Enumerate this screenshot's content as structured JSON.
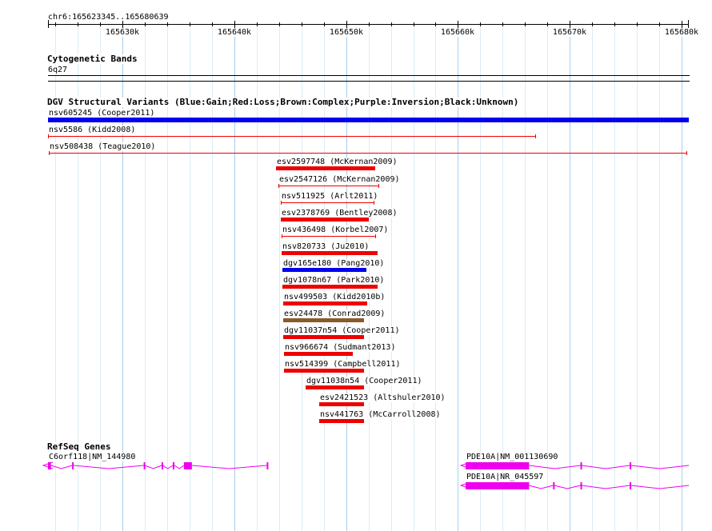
{
  "ruler": {
    "range_label": "chr6:165623345..165680639",
    "start": 165623345,
    "end": 165680639,
    "ticks": [
      {
        "pos": 165630000,
        "label": "165630k"
      },
      {
        "pos": 165640000,
        "label": "165640k"
      },
      {
        "pos": 165650000,
        "label": "165650k"
      },
      {
        "pos": 165660000,
        "label": "165660k"
      },
      {
        "pos": 165670000,
        "label": "165670k"
      },
      {
        "pos": 165680000,
        "label": "165680k"
      }
    ]
  },
  "cyto": {
    "title": "Cytogenetic Bands",
    "band": "6q27"
  },
  "dgv": {
    "title": "DGV Structural Variants (Blue:Gain;Red:Loss;Brown:Complex;Purple:Inversion;Black:Unknown)",
    "colors": {
      "gain": "#0000ee",
      "loss": "#ee0000",
      "complex": "#8b5a2b"
    },
    "variants": [
      {
        "label": "nsv605245 (Cooper2011)",
        "type": "gain",
        "style": "bar",
        "start": 165623345,
        "end": 165680639
      },
      {
        "label": "nsv5586 (Kidd2008)",
        "type": "loss",
        "style": "line",
        "start": 165623345,
        "end": 165667000
      },
      {
        "label": "nsv508438 (Teague2010)",
        "type": "loss",
        "style": "line",
        "start": 165623400,
        "end": 165680500
      },
      {
        "label": "esv2597748 (McKernan2009)",
        "type": "loss",
        "style": "bar",
        "start": 165643700,
        "end": 165652600
      },
      {
        "label": "esv2547126 (McKernan2009)",
        "type": "loss",
        "style": "line",
        "start": 165643950,
        "end": 165652950
      },
      {
        "label": "nsv511925 (Arlt2011)",
        "type": "loss",
        "style": "line",
        "start": 165644150,
        "end": 165652550
      },
      {
        "label": "esv2378769 (Bentley2008)",
        "type": "loss",
        "style": "bar",
        "start": 165644150,
        "end": 165652050
      },
      {
        "label": "nsv436498 (Korbel2007)",
        "type": "loss",
        "style": "line",
        "start": 165644250,
        "end": 165652650
      },
      {
        "label": "nsv820733 (Ju2010)",
        "type": "loss",
        "style": "bar",
        "start": 165644250,
        "end": 165652800
      },
      {
        "label": "dgv165e180 (Pang2010)",
        "type": "gain",
        "style": "bar",
        "start": 165644320,
        "end": 165651800
      },
      {
        "label": "dgv1078n67 (Park2010)",
        "type": "loss",
        "style": "bar",
        "start": 165644320,
        "end": 165652800
      },
      {
        "label": "nsv499503 (Kidd2010b)",
        "type": "loss",
        "style": "bar",
        "start": 165644400,
        "end": 165651900
      },
      {
        "label": "esv24478 (Conrad2009)",
        "type": "complex",
        "style": "bar",
        "start": 165644400,
        "end": 165651600
      },
      {
        "label": "dgv11037n54 (Cooper2011)",
        "type": "loss",
        "style": "bar",
        "start": 165644400,
        "end": 165651600
      },
      {
        "label": "nsv966674 (Sudmant2013)",
        "type": "loss",
        "style": "bar",
        "start": 165644470,
        "end": 165650600
      },
      {
        "label": "nsv514399 (Campbell2011)",
        "type": "loss",
        "style": "bar",
        "start": 165644470,
        "end": 165651600
      },
      {
        "label": "dgv11038n54 (Cooper2011)",
        "type": "loss",
        "style": "bar",
        "start": 165646400,
        "end": 165651600
      },
      {
        "label": "esv2421523 (Altshuler2010)",
        "type": "loss",
        "style": "bar",
        "start": 165647600,
        "end": 165651600
      },
      {
        "label": "nsv441763 (McCarroll2008)",
        "type": "loss",
        "style": "bar",
        "start": 165647600,
        "end": 165651600
      }
    ]
  },
  "genes": {
    "title": "RefSeq Genes",
    "color": "#ee00ee",
    "items": [
      {
        "label": "C6orf118|NM_144980",
        "strand": "minus",
        "start": 165623345,
        "end": 165643000,
        "exons": [
          [
            165623345,
            165623600
          ],
          [
            165625500,
            165625620
          ],
          [
            165631900,
            165632000
          ],
          [
            165633500,
            165633600
          ],
          [
            165634500,
            165634650
          ],
          [
            165635500,
            165636200
          ],
          [
            165642900,
            165643000
          ]
        ],
        "thick": [
          [
            165623345,
            165623600
          ],
          [
            165635500,
            165636200
          ]
        ]
      },
      {
        "label": "PDE10A|NM_001130690",
        "strand": "minus",
        "start": 165660700,
        "end": 165680639,
        "exons": [
          [
            165660700,
            165666350
          ],
          [
            165670950,
            165671050
          ],
          [
            165675350,
            165675450
          ]
        ],
        "thick": [
          [
            165660700,
            165666350
          ]
        ]
      },
      {
        "label": "PDE10A|NR_045597",
        "strand": "minus",
        "start": 165660700,
        "end": 165680639,
        "exons": [
          [
            165660700,
            165666350
          ],
          [
            165668500,
            165668600
          ],
          [
            165670950,
            165671050
          ],
          [
            165675350,
            165675450
          ]
        ],
        "thick": [
          [
            165660700,
            165666350
          ]
        ]
      }
    ]
  }
}
